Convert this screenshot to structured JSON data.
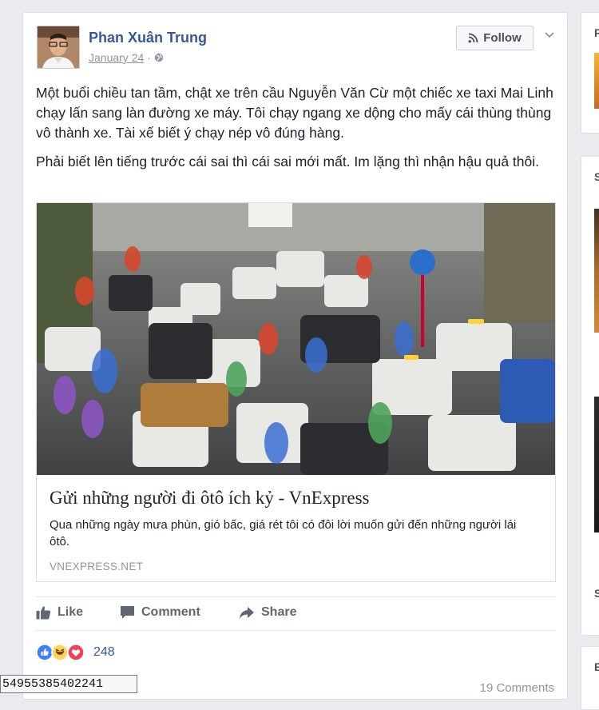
{
  "post": {
    "author": "Phan Xuân Trung",
    "date": "January 24",
    "date_separator": "·",
    "follow_label": "Follow",
    "paragraphs": [
      "Một buổi chiều tan tầm, chật xe trên cầu Nguyễn Văn Cừ một chiếc xe taxi Mai Linh chạy lấn sang làn đường xe máy. Tôi chạy ngang xe dộng cho mấy cái thùng thùng vô thành xe. Tài xế biết ý chạy nép vô đúng hàng.",
      "Phải biết lên tiếng trước cái sai thì cái sai mới mất. Im lặng thì nhận hậu quả thôi."
    ],
    "link": {
      "title": "Gửi những người đi ôtô ích kỷ - VnExpress",
      "description": "Qua những ngày mưa phùn, gió bấc, giá rét tôi có đôi lời muốn gửi đến những người lái ôtô.",
      "domain": "VNEXPRESS.NET"
    },
    "actions": {
      "like": "Like",
      "comment": "Comment",
      "share": "Share"
    },
    "reactions_count": "248",
    "comments_count": "19 Comments"
  },
  "right_column": {
    "letters": [
      "F",
      "S",
      "S",
      "E"
    ]
  },
  "tooltip_text": "54955385402241",
  "colors": {
    "link_blue": "#365899",
    "like_blue": "#4080ff",
    "love_red": "#f33e58",
    "haha_yellow": "#fdd65b"
  }
}
